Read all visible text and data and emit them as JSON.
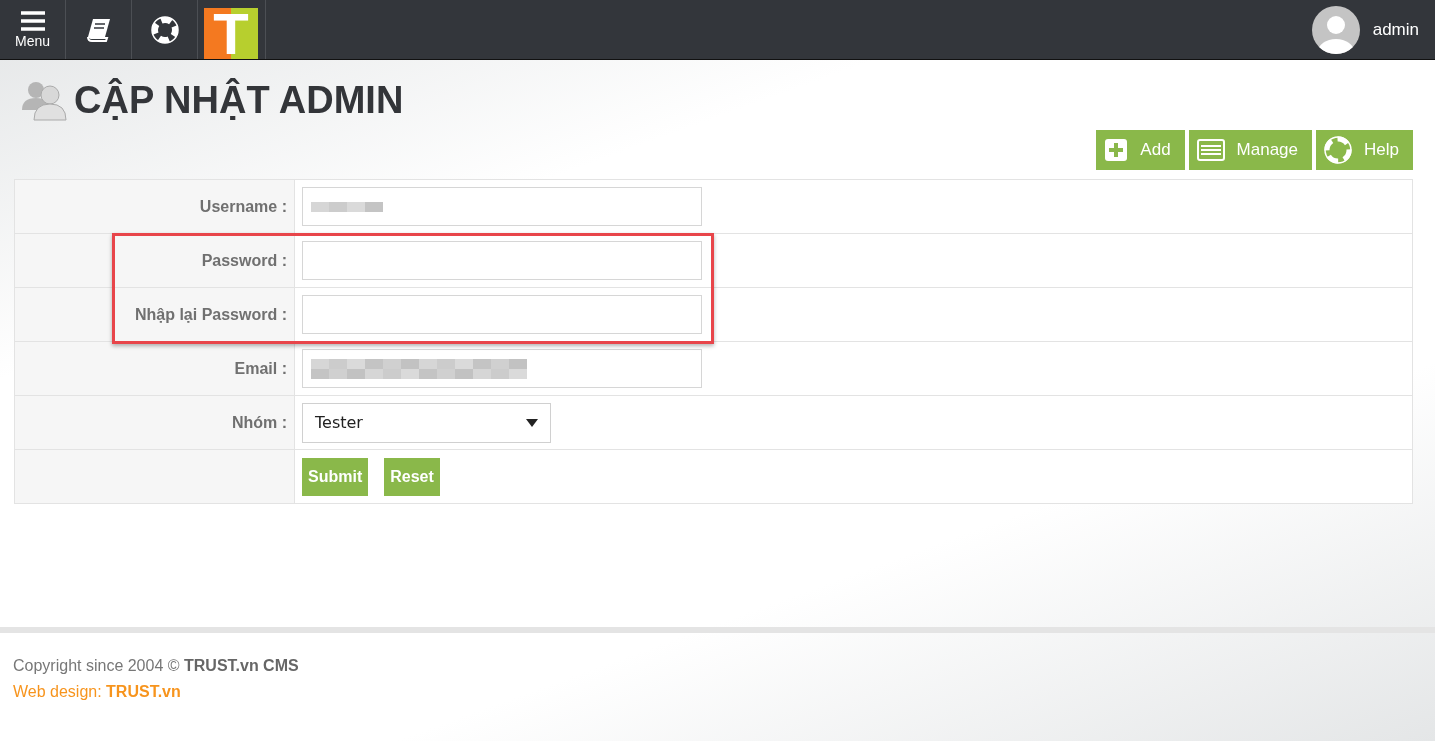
{
  "topbar": {
    "menu_label": "Menu",
    "logo": {
      "letter": "T"
    },
    "user": {
      "name": "admin"
    }
  },
  "page": {
    "title": "CẬP NHẬT ADMIN"
  },
  "actions": [
    {
      "kind": "add",
      "label": "Add"
    },
    {
      "kind": "manage",
      "label": "Manage"
    },
    {
      "kind": "help",
      "label": "Help"
    }
  ],
  "form": {
    "rows": [
      {
        "kind": "text",
        "label": "Username :",
        "redacted": true,
        "highlighted": false
      },
      {
        "kind": "password",
        "label": "Password :",
        "highlighted": true
      },
      {
        "kind": "password",
        "label": "Nhập lại Password :",
        "highlighted": true
      },
      {
        "kind": "text",
        "label": "Email :",
        "redacted": true,
        "highlighted": false
      },
      {
        "kind": "select",
        "label": "Nhóm :",
        "value": "Tester",
        "highlighted": false
      },
      {
        "kind": "buttons",
        "buttons": [
          "Submit",
          "Reset"
        ],
        "highlighted": false
      }
    ]
  },
  "footer": {
    "copyright": "Copyright since 2004 © **TRUST.vn CMS**",
    "credit": "Web design: **TRUST.vn**"
  }
}
